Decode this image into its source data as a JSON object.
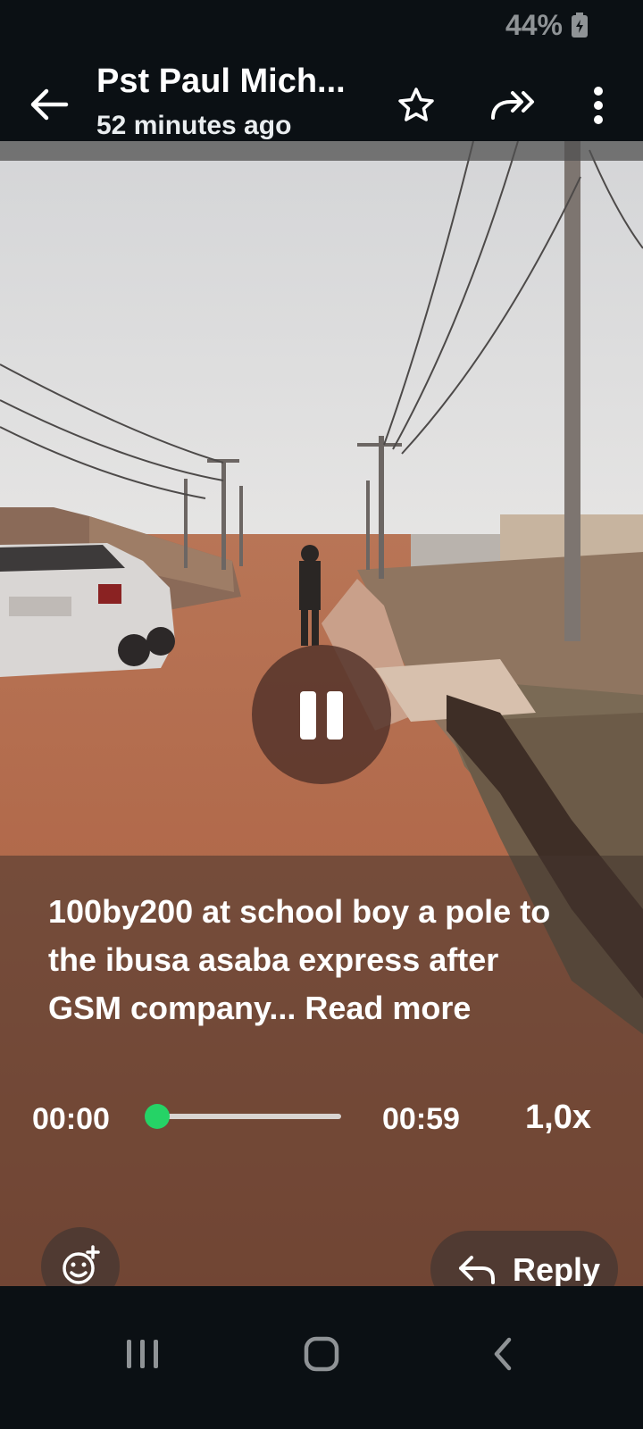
{
  "status_bar": {
    "battery": "44%"
  },
  "header": {
    "contact_name": "Pst Paul Mich...",
    "time_ago": "52 minutes ago"
  },
  "icons": {
    "back": "back-arrow-icon",
    "star": "star-icon",
    "forward": "forward-icon",
    "more": "more-vert-icon",
    "pause": "pause-icon",
    "emoji": "emoji-add-icon",
    "reply": "reply-icon",
    "nav_recents": "recents-icon",
    "nav_home": "home-icon",
    "nav_back": "nav-back-icon"
  },
  "caption": {
    "line1": "100by200 at school boy a pole to",
    "line2": "the ibusa asaba express after",
    "line3": "GSM company... ",
    "read_more": "Read more"
  },
  "player": {
    "current_time": "00:00",
    "duration": "00:59",
    "speed": "1,0x",
    "progress": 0.0
  },
  "actions": {
    "reply_label": "Reply"
  },
  "colors": {
    "accent": "#25d366",
    "background": "#0b1014"
  }
}
